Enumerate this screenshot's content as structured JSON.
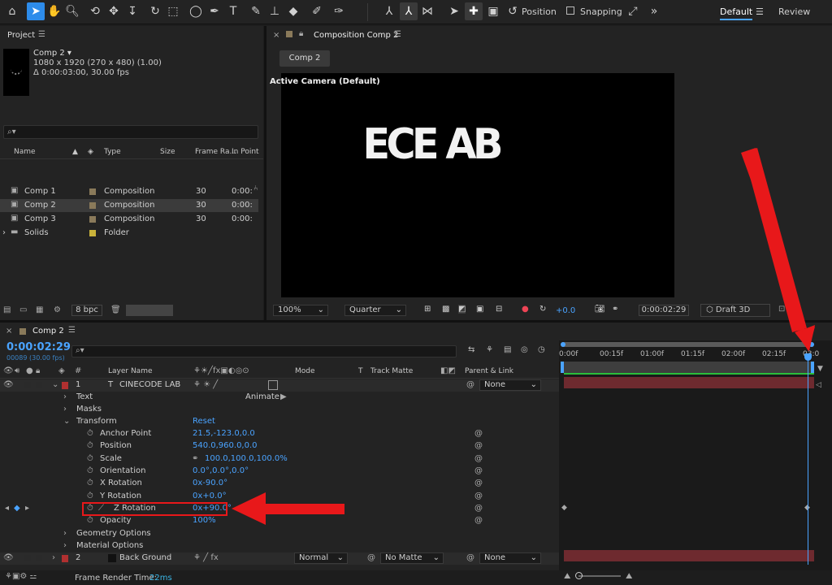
{
  "toolbar": {
    "position_label": "Position",
    "snapping_label": "Snapping",
    "workspace_default": "Default",
    "workspace_review": "Review"
  },
  "project": {
    "panel_title": "Project",
    "comp_name": "Comp 2",
    "comp_dims": "1080 x 1920  (270 x 480) (1.00)",
    "comp_duration": "Δ 0:00:03:00, 30.00 fps",
    "search_placeholder": "",
    "columns": [
      "Name",
      "Type",
      "Size",
      "Frame Ra...",
      "In Point"
    ],
    "items": [
      {
        "name": "Comp 1",
        "type": "Composition",
        "fps": "30",
        "in": "0:00:",
        "color": "#8a7a5a",
        "selected": false
      },
      {
        "name": "Comp 2",
        "type": "Composition",
        "fps": "30",
        "in": "0:00:",
        "color": "#8a7a5a",
        "selected": true
      },
      {
        "name": "Comp 3",
        "type": "Composition",
        "fps": "30",
        "in": "0:00:",
        "color": "#8a7a5a",
        "selected": false
      },
      {
        "name": "Solids",
        "type": "Folder",
        "fps": "",
        "in": "",
        "color": "#c9b23a",
        "selected": false
      }
    ],
    "bpc_label": "8 bpc"
  },
  "viewer": {
    "tab_title": "Composition Comp 2",
    "sub_tab": "Comp 2",
    "camera_label": "Active Camera (Default)",
    "canvas_text": "ECE AB",
    "zoom": "100%",
    "resolution": "Quarter",
    "exposure": "+0.0",
    "timecode": "0:00:02:29",
    "renderer": "Draft 3D"
  },
  "timeline": {
    "tab_title": "Comp 2",
    "current_time": "0:00:02:29",
    "frame_info": "00089 (30.00 fps)",
    "ruler": [
      "0:00f",
      "00:15f",
      "01:00f",
      "01:15f",
      "02:00f",
      "02:15f",
      "03:0"
    ],
    "col_layer_name": "Layer Name",
    "col_mode": "Mode",
    "col_t": "T",
    "col_trkmat": "Track Matte",
    "col_parent": "Parent & Link",
    "layer1_num": "1",
    "layer1_name": "CINECODE LAB",
    "layer1_parent": "None",
    "text_label": "Text",
    "animate_label": "Animate:",
    "masks_label": "Masks",
    "transform_label": "Transform",
    "reset_label": "Reset",
    "props": [
      {
        "name": "Anchor Point",
        "value": "21.5,-123.0,0.0"
      },
      {
        "name": "Position",
        "value": "540.0,960.0,0.0"
      },
      {
        "name": "Scale",
        "value": "100.0,100.0,100.0%"
      },
      {
        "name": "Orientation",
        "value": "0.0°,0.0°,0.0°"
      },
      {
        "name": "X Rotation",
        "value": "0x-90.0°"
      },
      {
        "name": "Y Rotation",
        "value": "0x+0.0°"
      },
      {
        "name": "Z Rotation",
        "value": "0x+90.0°"
      },
      {
        "name": "Opacity",
        "value": "100%"
      }
    ],
    "geometry_label": "Geometry Options",
    "material_label": "Material Options",
    "layer2_num": "2",
    "layer2_name": "Back Ground",
    "layer2_mode": "Normal",
    "layer2_matte": "No Matte",
    "layer2_parent": "None",
    "render_time_label": "Frame Render Time:",
    "render_time_value": "22ms"
  },
  "colors": {
    "accent_blue": "#4aa3ff",
    "annotation_red": "#e8181a",
    "layer_red": "#b03030",
    "bar_red": "#6e2a2f"
  }
}
